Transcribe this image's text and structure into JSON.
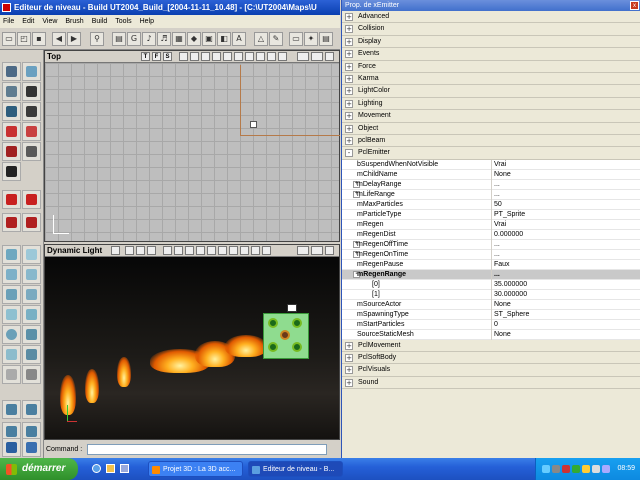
{
  "main_window": {
    "title": "Editeur de niveau - Build UT2004_Build_[2004-11-11_10.48] - [C:\\UT2004\\Maps\\U",
    "menu": [
      "File",
      "Edit",
      "View",
      "Brush",
      "Build",
      "Tools",
      "Help"
    ]
  },
  "viewports": {
    "top": {
      "label": "Top",
      "mode_buttons": [
        "T",
        "F",
        "S"
      ]
    },
    "perspective": {
      "label": "Dynamic Light"
    }
  },
  "command_bar": {
    "label": "Command :",
    "value": ""
  },
  "properties": {
    "title": "Prop. de xEmitter",
    "close_label": "x",
    "categories_before": [
      "Advanced",
      "Collision",
      "Display",
      "Events",
      "Force",
      "Karma",
      "LightColor",
      "Lighting",
      "Movement",
      "Object",
      "pclBeam"
    ],
    "open_category": "PclEmitter",
    "rows": [
      {
        "name": "bSuspendWhenNotVisible",
        "value": "Vrai",
        "expander": "",
        "selected": false
      },
      {
        "name": "mChildName",
        "value": "None",
        "expander": "",
        "selected": false
      },
      {
        "name": "mDelayRange",
        "value": "...",
        "expander": "+",
        "selected": false
      },
      {
        "name": "mLifeRange",
        "value": "...",
        "expander": "+",
        "selected": false
      },
      {
        "name": "mMaxParticles",
        "value": "50",
        "expander": "",
        "selected": false
      },
      {
        "name": "mParticleType",
        "value": "PT_Sprite",
        "expander": "",
        "selected": false
      },
      {
        "name": "mRegen",
        "value": "Vrai",
        "expander": "",
        "selected": false
      },
      {
        "name": "mRegenDist",
        "value": "0.000000",
        "expander": "",
        "selected": false
      },
      {
        "name": "mRegenOffTime",
        "value": "...",
        "expander": "+",
        "selected": false
      },
      {
        "name": "mRegenOnTime",
        "value": "...",
        "expander": "+",
        "selected": false
      },
      {
        "name": "mRegenPause",
        "value": "Faux",
        "expander": "",
        "selected": false
      },
      {
        "name": "mRegenRange",
        "value": "...",
        "expander": "-",
        "selected": true
      },
      {
        "name": "[0]",
        "value": "35.000000",
        "expander": "",
        "selected": false,
        "indent": true
      },
      {
        "name": "[1]",
        "value": "30.000000",
        "expander": "",
        "selected": false,
        "indent": true
      },
      {
        "name": "mSourceActor",
        "value": "None",
        "expander": "",
        "selected": false
      },
      {
        "name": "mSpawningType",
        "value": "ST_Sphere",
        "expander": "",
        "selected": false
      },
      {
        "name": "mStartParticles",
        "value": "0",
        "expander": "",
        "selected": false
      },
      {
        "name": "SourceStaticMesh",
        "value": "None",
        "expander": "",
        "selected": false
      }
    ],
    "categories_after": [
      "PclMovement",
      "PclSoftBody",
      "PclVisuals",
      "Sound"
    ]
  },
  "taskbar": {
    "start_label": "démarrer",
    "tasks": [
      {
        "label": "Projet 3D : La 3D acc...",
        "active": false
      },
      {
        "label": "Editeur de niveau - B...",
        "active": true
      }
    ],
    "clock": "08:59"
  }
}
